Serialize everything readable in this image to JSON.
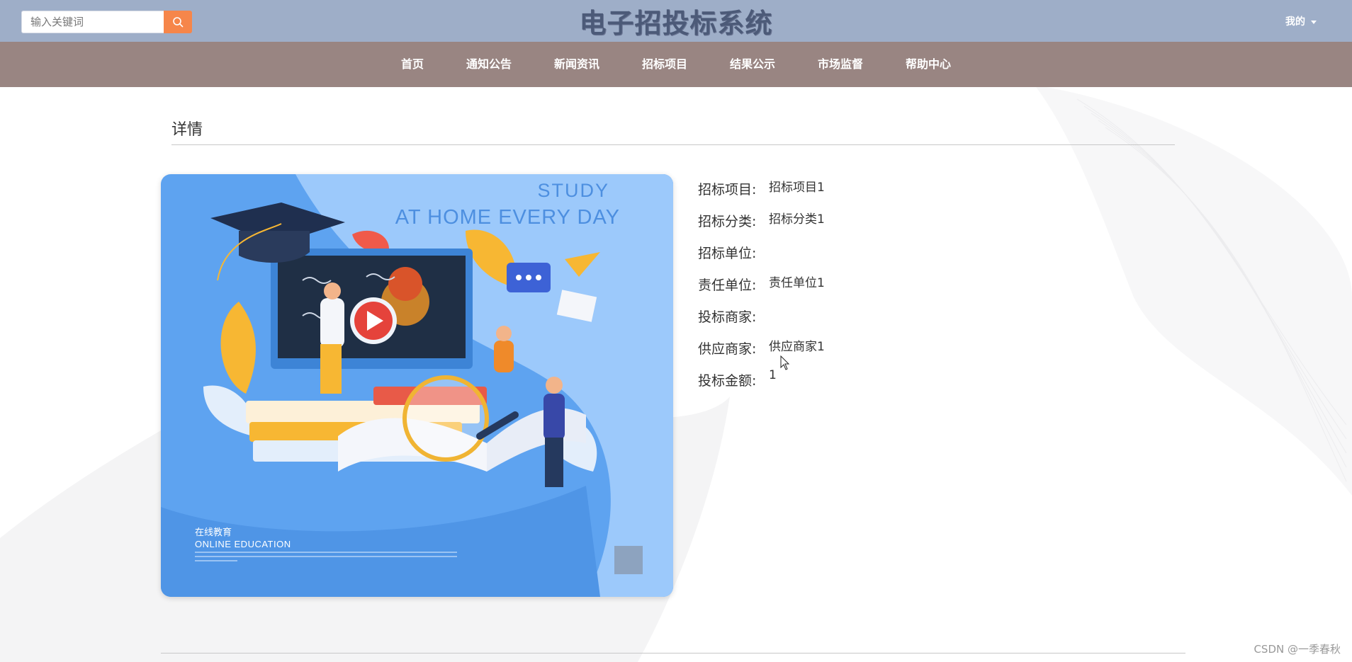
{
  "header": {
    "search": {
      "placeholder": "输入关键词"
    },
    "title": "电子招投标系统",
    "user_menu_label": "我的"
  },
  "nav": {
    "items": [
      {
        "label": "首页"
      },
      {
        "label": "通知公告"
      },
      {
        "label": "新闻资讯"
      },
      {
        "label": "招标项目"
      },
      {
        "label": "结果公示"
      },
      {
        "label": "市场监督"
      },
      {
        "label": "帮助中心"
      }
    ]
  },
  "detail": {
    "section_title": "详情",
    "image": {
      "headline_line1": "STUDY",
      "headline_line2": "AT HOME EVERY DAY",
      "caption_cn": "在线教育",
      "caption_en": "ONLINE EDUCATION"
    },
    "fields": [
      {
        "label": "招标项目:",
        "value": "招标项目1"
      },
      {
        "label": "招标分类:",
        "value": "招标分类1"
      },
      {
        "label": "招标单位:",
        "value": ""
      },
      {
        "label": "责任单位:",
        "value": "责任单位1"
      },
      {
        "label": "投标商家:",
        "value": ""
      },
      {
        "label": "供应商家:",
        "value": "供应商家1"
      },
      {
        "label": "投标金额:",
        "value": "1"
      }
    ]
  },
  "watermark": "CSDN @一季春秋",
  "colors": {
    "topbar": "#9eaec8",
    "navbar": "#998582",
    "search_button": "#f6864a",
    "hero_bg": "#5ea3f0"
  }
}
